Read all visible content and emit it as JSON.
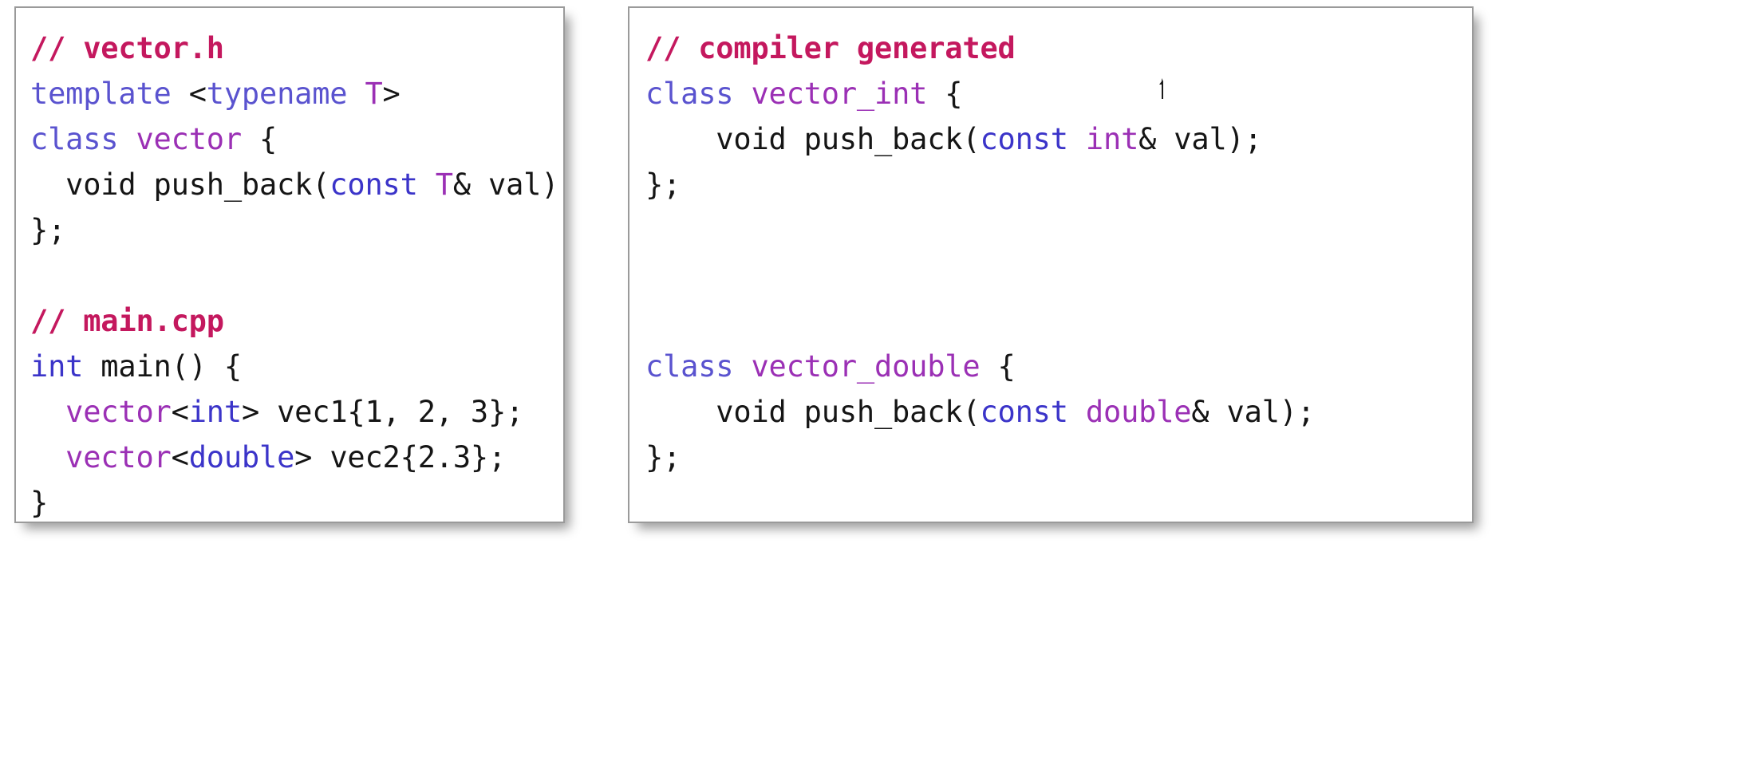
{
  "figure": {
    "background_color": "#ffffff",
    "panel_border_color": "#9a9a9a",
    "palette": {
      "comment": "#c4185e",
      "keyword": "#3b34c9",
      "keyword_soft": "#5a53cf",
      "type": "#9b30b5",
      "plain": "#151515"
    }
  },
  "left_panel": {
    "name": "source-code-panel",
    "lines": [
      {
        "id": "l1",
        "text": "// vector.h",
        "tokens": [
          {
            "t": "// vector.h",
            "c": "comment"
          }
        ]
      },
      {
        "id": "l2",
        "text": "template <typename T>",
        "tokens": [
          {
            "t": "template",
            "c": "keyword-soft"
          },
          {
            "t": " ",
            "c": "plain"
          },
          {
            "t": "<",
            "c": "plain"
          },
          {
            "t": "typename",
            "c": "keyword-soft"
          },
          {
            "t": " ",
            "c": "plain"
          },
          {
            "t": "T",
            "c": "type"
          },
          {
            "t": ">",
            "c": "plain"
          }
        ]
      },
      {
        "id": "l3",
        "text": "class vector {",
        "tokens": [
          {
            "t": "class",
            "c": "keyword-soft"
          },
          {
            "t": " ",
            "c": "plain"
          },
          {
            "t": "vector",
            "c": "type"
          },
          {
            "t": " {",
            "c": "plain"
          }
        ]
      },
      {
        "id": "l4",
        "text": "  void push_back(const T& val);",
        "tokens": [
          {
            "t": "  void push_back(",
            "c": "plain"
          },
          {
            "t": "const",
            "c": "keyword"
          },
          {
            "t": " ",
            "c": "plain"
          },
          {
            "t": "T",
            "c": "type"
          },
          {
            "t": "& val);",
            "c": "plain"
          }
        ]
      },
      {
        "id": "l5",
        "text": "};",
        "tokens": [
          {
            "t": "};",
            "c": "plain"
          }
        ]
      },
      {
        "id": "l6",
        "text": "",
        "tokens": [
          {
            "t": " ",
            "c": "plain"
          }
        ]
      },
      {
        "id": "l7",
        "text": "// main.cpp",
        "tokens": [
          {
            "t": "// main.cpp",
            "c": "comment"
          }
        ]
      },
      {
        "id": "l8",
        "text": "int main() {",
        "tokens": [
          {
            "t": "int",
            "c": "keyword"
          },
          {
            "t": " main() {",
            "c": "plain"
          }
        ]
      },
      {
        "id": "l9",
        "text": "  vector<int> vec1{1, 2, 3};",
        "tokens": [
          {
            "t": "  ",
            "c": "plain"
          },
          {
            "t": "vector",
            "c": "type"
          },
          {
            "t": "<",
            "c": "plain"
          },
          {
            "t": "int",
            "c": "keyword"
          },
          {
            "t": "> vec1{1, 2, 3};",
            "c": "plain"
          }
        ]
      },
      {
        "id": "l10",
        "text": "  vector<double> vec2{2.3};",
        "tokens": [
          {
            "t": "  ",
            "c": "plain"
          },
          {
            "t": "vector",
            "c": "type"
          },
          {
            "t": "<",
            "c": "plain"
          },
          {
            "t": "double",
            "c": "keyword"
          },
          {
            "t": "> vec2{2.3};",
            "c": "plain"
          }
        ]
      },
      {
        "id": "l11",
        "text": "}",
        "tokens": [
          {
            "t": "}",
            "c": "plain"
          }
        ]
      }
    ]
  },
  "right_panel": {
    "name": "compiler-generated-panel",
    "lines": [
      {
        "id": "r1",
        "text": "// compiler generated",
        "tokens": [
          {
            "t": "// compiler generated",
            "c": "comment"
          }
        ]
      },
      {
        "id": "r2",
        "text": "class vector_int {",
        "tokens": [
          {
            "t": "class",
            "c": "keyword-soft"
          },
          {
            "t": " ",
            "c": "plain"
          },
          {
            "t": "vector_int",
            "c": "type"
          },
          {
            "t": " {",
            "c": "plain"
          }
        ]
      },
      {
        "id": "r3",
        "text": "    void push_back(const int& val);",
        "tokens": [
          {
            "t": "    void push_back(",
            "c": "plain"
          },
          {
            "t": "const",
            "c": "keyword"
          },
          {
            "t": " ",
            "c": "plain"
          },
          {
            "t": "int",
            "c": "type"
          },
          {
            "t": "& val);",
            "c": "plain"
          }
        ]
      },
      {
        "id": "r4",
        "text": "};",
        "tokens": [
          {
            "t": "};",
            "c": "plain"
          }
        ]
      },
      {
        "id": "r5",
        "text": "",
        "tokens": [
          {
            "t": " ",
            "c": "plain"
          }
        ]
      },
      {
        "id": "r6",
        "text": "",
        "tokens": [
          {
            "t": " ",
            "c": "plain"
          }
        ]
      },
      {
        "id": "r7",
        "text": "",
        "tokens": [
          {
            "t": " ",
            "c": "plain"
          }
        ]
      },
      {
        "id": "r8",
        "text": "class vector_double {",
        "tokens": [
          {
            "t": "class",
            "c": "keyword-soft"
          },
          {
            "t": " ",
            "c": "plain"
          },
          {
            "t": "vector_double",
            "c": "type"
          },
          {
            "t": " {",
            "c": "plain"
          }
        ]
      },
      {
        "id": "r9",
        "text": "    void push_back(const double& val);",
        "tokens": [
          {
            "t": "    void push_back(",
            "c": "plain"
          },
          {
            "t": "const",
            "c": "keyword"
          },
          {
            "t": " ",
            "c": "plain"
          },
          {
            "t": "double",
            "c": "type"
          },
          {
            "t": "& val);",
            "c": "plain"
          }
        ]
      },
      {
        "id": "r10",
        "text": "};",
        "tokens": [
          {
            "t": "};",
            "c": "plain"
          }
        ]
      }
    ]
  },
  "cursor": {
    "name": "text-beam-cursor",
    "visible": true
  }
}
